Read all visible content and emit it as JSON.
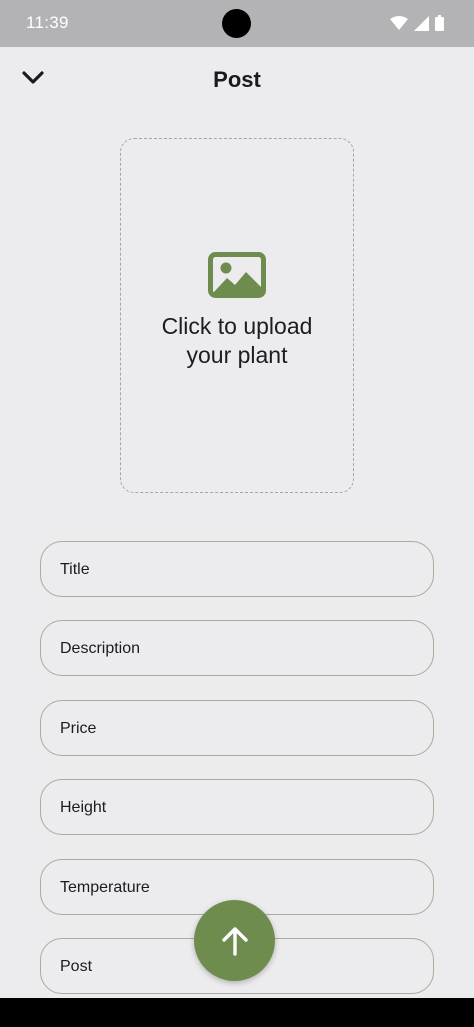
{
  "status_bar": {
    "time": "11:39"
  },
  "header": {
    "title": "Post"
  },
  "upload": {
    "line1": "Click to upload",
    "line2": "your plant"
  },
  "form": {
    "fields": [
      {
        "label": "Title"
      },
      {
        "label": "Description"
      },
      {
        "label": "Price"
      },
      {
        "label": "Height"
      },
      {
        "label": "Temperature"
      },
      {
        "label": "Post"
      }
    ]
  },
  "colors": {
    "accent": "#6e8c4e",
    "background": "#ececee",
    "field_border": "#a8ad9c"
  },
  "icons": {
    "back": "chevron-down-icon",
    "upload": "image-icon",
    "submit": "arrow-up-icon"
  }
}
